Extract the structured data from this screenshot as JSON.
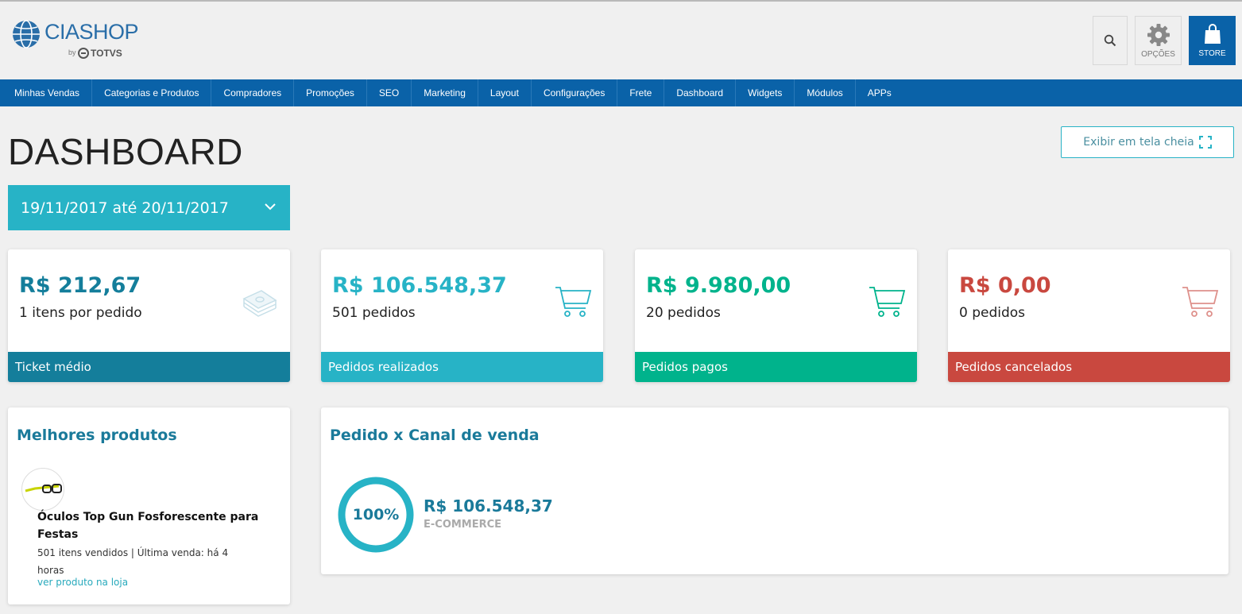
{
  "header": {
    "logo_text": "CIASHOP",
    "logo_by": "by",
    "logo_brand": "TOTVS",
    "search_icon": "search-icon",
    "options_label": "OPÇÕES",
    "store_label": "STORE"
  },
  "nav": {
    "items": [
      "Minhas Vendas",
      "Categorias e Produtos",
      "Compradores",
      "Promoções",
      "SEO",
      "Marketing",
      "Layout",
      "Configurações",
      "Frete",
      "Dashboard",
      "Widgets",
      "Módulos",
      "APPs"
    ]
  },
  "page": {
    "title": "DASHBOARD",
    "fullscreen_label": "Exibir em tela cheia",
    "date_range": "19/11/2017 até 20/11/2017"
  },
  "stats": [
    {
      "value": "R$ 212,67",
      "sub": "1 itens por pedido",
      "footer": "Ticket médio",
      "color": "#147e9b",
      "icon": "money-stack-icon"
    },
    {
      "value": "R$ 106.548,37",
      "sub": "501 pedidos",
      "footer": "Pedidos realizados",
      "color": "#27b3c6",
      "icon": "cart-icon"
    },
    {
      "value": "R$ 9.980,00",
      "sub": "20 pedidos",
      "footer": "Pedidos pagos",
      "color": "#00b38c",
      "icon": "cart-icon"
    },
    {
      "value": "R$ 0,00",
      "sub": "0 pedidos",
      "footer": "Pedidos cancelados",
      "color": "#c9483f",
      "icon": "cart-icon"
    }
  ],
  "best_products": {
    "title": "Melhores produtos",
    "product_name": "Óculos Top Gun Fosforescente para Festas",
    "product_meta": "501 itens vendidos | Última venda: há 4 horas",
    "product_link": "ver produto na loja"
  },
  "channels": {
    "title": "Pedido x Canal de venda",
    "percent": "100%",
    "value": "R$ 106.548,37",
    "name": "E-COMMERCE"
  }
}
